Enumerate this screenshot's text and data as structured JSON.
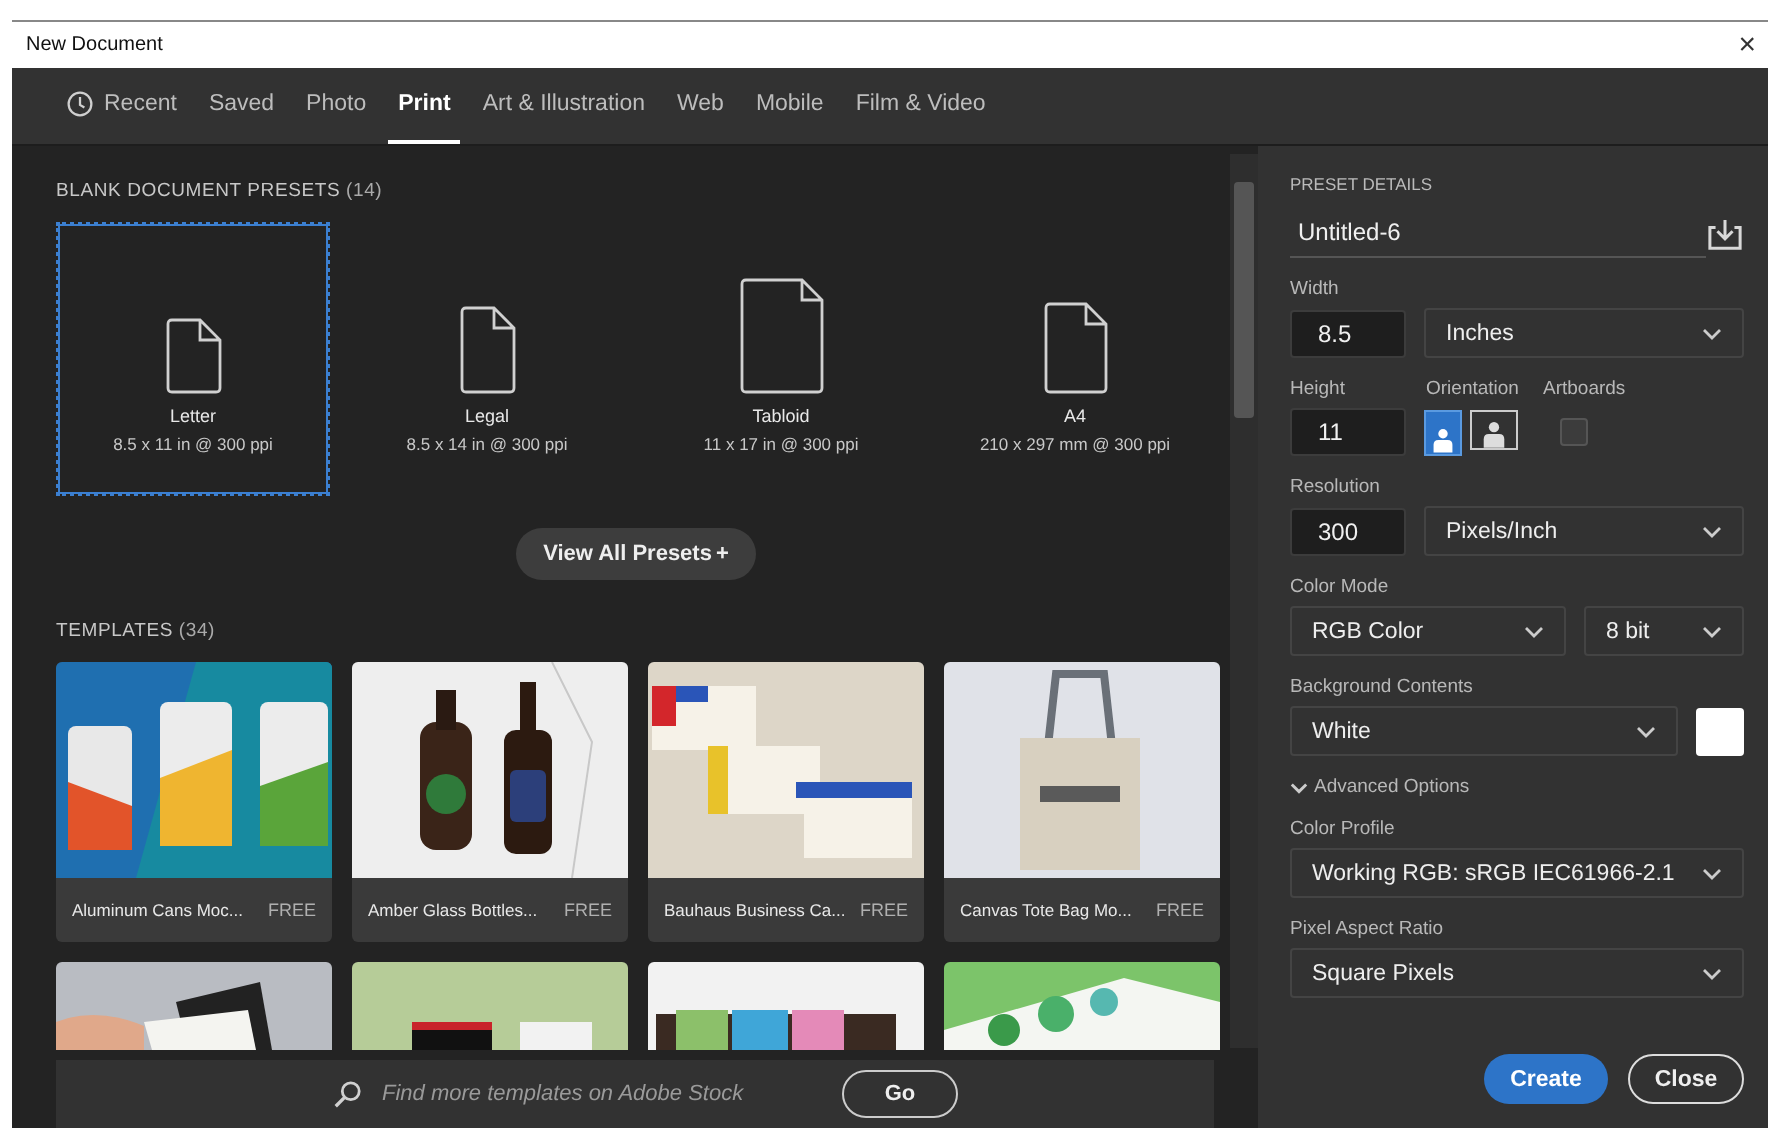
{
  "window": {
    "title": "New Document",
    "close": "×"
  },
  "tabs": [
    {
      "label": "Recent",
      "kind": "history",
      "selected": false
    },
    {
      "label": "Saved",
      "kind": "plain",
      "selected": false
    },
    {
      "label": "Photo",
      "kind": "plain",
      "selected": false
    },
    {
      "label": "Print",
      "kind": "plain",
      "selected": true
    },
    {
      "label": "Art & Illustration",
      "kind": "plain",
      "selected": false
    },
    {
      "label": "Web",
      "kind": "plain",
      "selected": false
    },
    {
      "label": "Mobile",
      "kind": "plain",
      "selected": false
    },
    {
      "label": "Film & Video",
      "kind": "plain",
      "selected": false
    }
  ],
  "presets": {
    "title": "BLANK DOCUMENT PRESETS",
    "count": "(14)",
    "view_all": "View All Presets",
    "view_all_icon": "+",
    "items": [
      {
        "name": "Letter",
        "size": "8.5 x 11 in @ 300 ppi",
        "kind": "letter",
        "selected": true
      },
      {
        "name": "Legal",
        "size": "8.5 x 14 in @ 300 ppi",
        "kind": "legal",
        "selected": false
      },
      {
        "name": "Tabloid",
        "size": "11 x 17 in @ 300 ppi",
        "kind": "tabloid",
        "selected": false
      },
      {
        "name": "A4",
        "size": "210 x 297 mm @ 300 ppi",
        "kind": "a4",
        "selected": false
      }
    ]
  },
  "templates": {
    "title": "TEMPLATES",
    "count": "(34)",
    "items": [
      {
        "name": "Aluminum Cans Moc...",
        "badge": "FREE",
        "kind": "picture"
      },
      {
        "name": "Amber Glass Bottles...",
        "badge": "FREE",
        "kind": "picture"
      },
      {
        "name": "Bauhaus Business Ca...",
        "badge": "FREE",
        "kind": "picture"
      },
      {
        "name": "Canvas Tote Bag Mo...",
        "badge": "FREE",
        "kind": "picture"
      }
    ]
  },
  "stock_search": {
    "placeholder": "Find more templates on Adobe Stock",
    "button": "Go"
  },
  "preset_details": {
    "title": "PRESET DETAILS",
    "name": "Untitled-6",
    "width": {
      "label": "Width",
      "value": "8.5",
      "unit": "Inches"
    },
    "height": {
      "label": "Height",
      "value": "11"
    },
    "orientation": {
      "label": "Orientation",
      "options": [
        {
          "kind": "portrait",
          "selected": true
        },
        {
          "kind": "landscape",
          "selected": false
        }
      ]
    },
    "artboards": {
      "label": "Artboards",
      "checked": false
    },
    "resolution": {
      "label": "Resolution",
      "value": "300",
      "unit": "Pixels/Inch"
    },
    "color_mode": {
      "label": "Color Mode",
      "value": "RGB Color",
      "depth": "8 bit"
    },
    "background": {
      "label": "Background Contents",
      "value": "White",
      "color": "#ffffff"
    },
    "advanced": {
      "label": "Advanced Options",
      "expanded": true
    },
    "color_profile": {
      "label": "Color Profile",
      "value": "Working RGB: sRGB IEC61966-2.1"
    },
    "pixel_aspect": {
      "label": "Pixel Aspect Ratio",
      "value": "Square Pixels"
    },
    "buttons": [
      {
        "label": "Create",
        "kind": "primary"
      },
      {
        "label": "Close",
        "kind": "secondary"
      }
    ]
  }
}
